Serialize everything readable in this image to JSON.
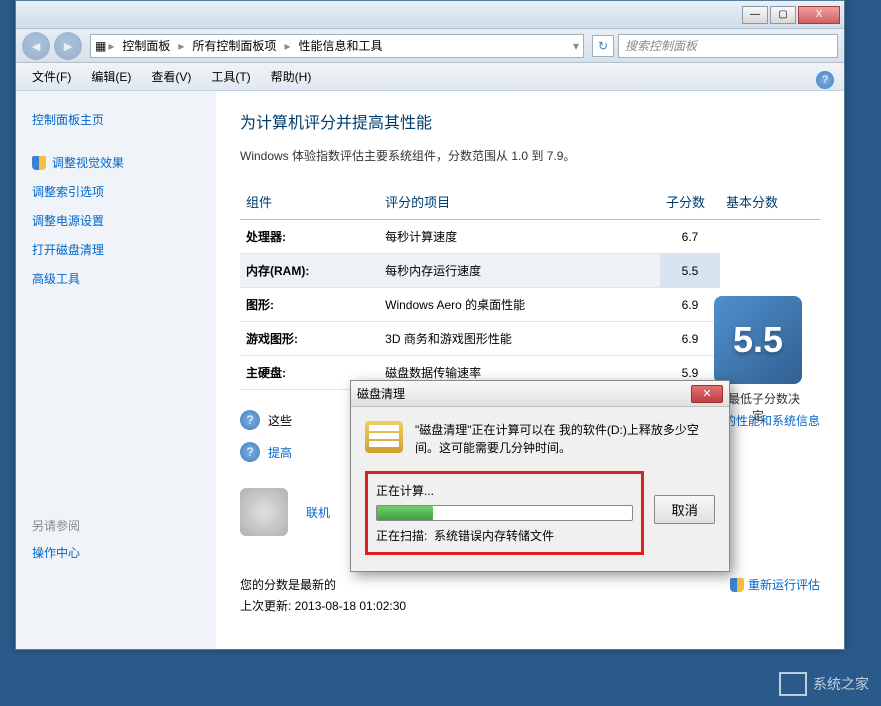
{
  "titlebar": {
    "min": "—",
    "max": "▢",
    "close": "X"
  },
  "nav": {
    "breadcrumb": [
      "控制面板",
      "所有控制面板项",
      "性能信息和工具"
    ],
    "search_placeholder": "搜索控制面板"
  },
  "menu": [
    "文件(F)",
    "编辑(E)",
    "查看(V)",
    "工具(T)",
    "帮助(H)"
  ],
  "sidebar": {
    "home": "控制面板主页",
    "links": [
      "调整视觉效果",
      "调整索引选项",
      "调整电源设置",
      "打开磁盘清理",
      "高级工具"
    ],
    "seealso_label": "另请参阅",
    "seealso_link": "操作中心"
  },
  "main": {
    "title": "为计算机评分并提高其性能",
    "desc": "Windows 体验指数评估主要系统组件，分数范围从 1.0 到 7.9。",
    "headers": {
      "component": "组件",
      "item": "评分的项目",
      "subscore": "子分数",
      "basescore": "基本分数"
    },
    "rows": [
      {
        "c": "处理器:",
        "i": "每秒计算速度",
        "s": "6.7"
      },
      {
        "c": "内存(RAM):",
        "i": "每秒内存运行速度",
        "s": "5.5"
      },
      {
        "c": "图形:",
        "i": "Windows Aero 的桌面性能",
        "s": "6.9"
      },
      {
        "c": "游戏图形:",
        "i": "3D 商务和游戏图形性能",
        "s": "6.9"
      },
      {
        "c": "主硬盘:",
        "i": "磁盘数据传输速率",
        "s": "5.9"
      }
    ],
    "bigscore": "5.5",
    "bigscore_label": "由最低子分数决定",
    "info_links": {
      "l1_prefix": "这些",
      "l1_suffix": "细的性能和系统信息",
      "l2": "提高"
    },
    "linked": "联机",
    "footer_status": "您的分数是最新的",
    "footer_update": "上次更新: 2013-08-18 01:02:30",
    "rerun": "重新运行评估"
  },
  "dialog": {
    "title": "磁盘清理",
    "message": "\"磁盘清理\"正在计算可以在 我的软件(D:)上释放多少空间。这可能需要几分钟时间。",
    "calculating": "正在计算...",
    "scanning_label": "正在扫描:",
    "scanning_item": "系统错误内存转储文件",
    "cancel": "取消"
  },
  "watermark": "系统之家"
}
